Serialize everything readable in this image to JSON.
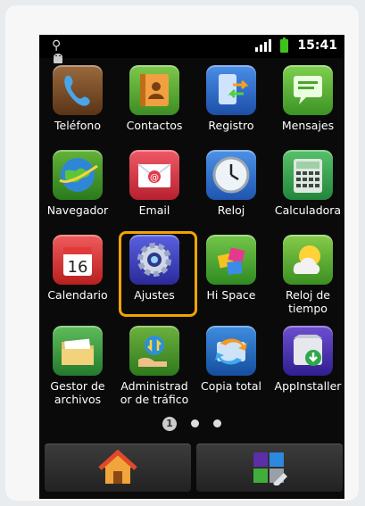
{
  "status_bar": {
    "left_icons": [
      "usb-icon",
      "android-icon"
    ],
    "right_icons": [
      "signal-icon",
      "battery-icon"
    ],
    "time": "15:41"
  },
  "apps": [
    {
      "label": "Teléfono",
      "icon": "phone-icon",
      "color": "#7a4a23"
    },
    {
      "label": "Contactos",
      "icon": "contacts-icon",
      "color": "#e9a23b"
    },
    {
      "label": "Registro",
      "icon": "call-log-icon",
      "color": "#2b64c8"
    },
    {
      "label": "Mensajes",
      "icon": "messages-icon",
      "color": "#5fb335"
    },
    {
      "label": "Navegador",
      "icon": "globe-icon",
      "color": "#2b8ad1"
    },
    {
      "label": "Email",
      "icon": "email-icon",
      "color": "#d93b4a"
    },
    {
      "label": "Reloj",
      "icon": "clock-icon",
      "color": "#2c74c9"
    },
    {
      "label": "Calculadora",
      "icon": "calculator-icon",
      "color": "#2d9f4a"
    },
    {
      "label": "Calendario",
      "icon": "calendar-icon",
      "color": "#e23a3a",
      "day": "16"
    },
    {
      "label": "Ajustes",
      "icon": "gear-icon",
      "color": "#3b3fb8"
    },
    {
      "label": "Hi Space",
      "icon": "hi-space-icon",
      "color": "#4cae3a"
    },
    {
      "label": "Reloj de tiempo",
      "icon": "weather-icon",
      "color": "#6ab233"
    },
    {
      "label": "Gestor de archivos",
      "icon": "folder-icon",
      "color": "#3aa34a"
    },
    {
      "label": "Administrad or de tráfico",
      "icon": "traffic-icon",
      "color": "#4e9b2f"
    },
    {
      "label": "Copia total",
      "icon": "backup-icon",
      "color": "#1f6fc4"
    },
    {
      "label": "AppInstaller",
      "icon": "app-installer-icon",
      "color": "#5b3ab5"
    }
  ],
  "page_indicator": {
    "current": "1",
    "pages": 3
  },
  "dock": {
    "left_icon": "home-icon",
    "right_icon": "apps-icon"
  },
  "colors": {
    "highlight": "#f1a400",
    "battery": "#3ec21c"
  }
}
